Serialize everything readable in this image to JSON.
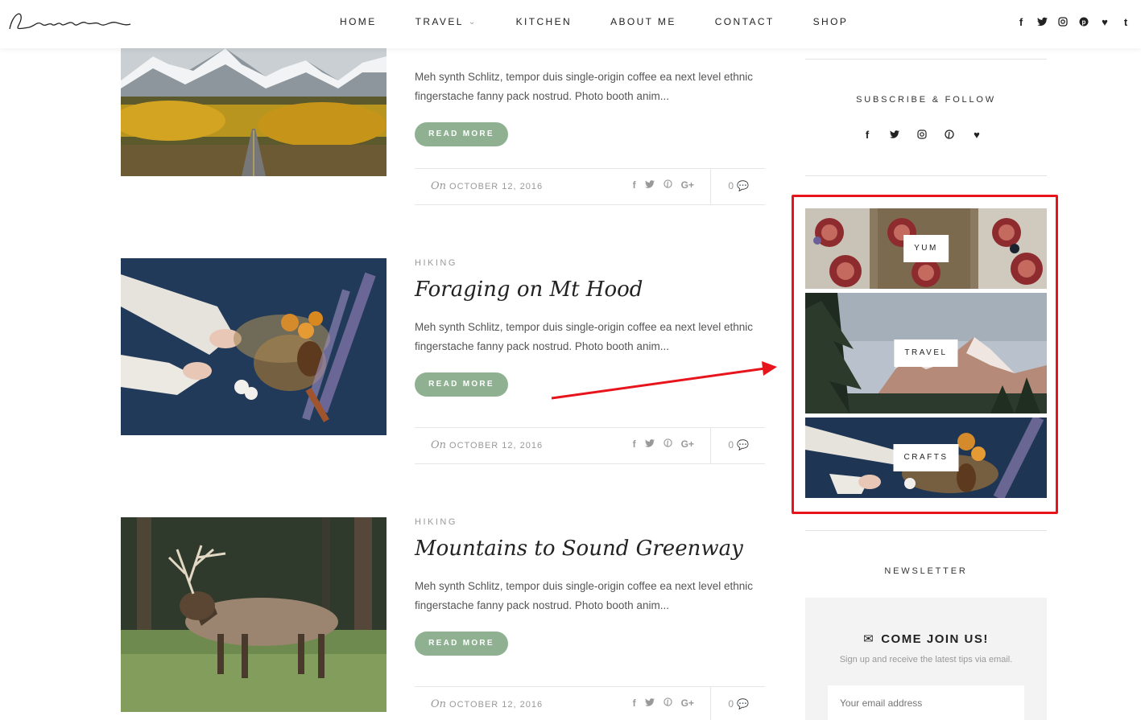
{
  "header": {
    "logo_text": "Laurel",
    "nav": [
      {
        "label": "HOME"
      },
      {
        "label": "TRAVEL"
      },
      {
        "label": "KITCHEN"
      },
      {
        "label": "ABOUT ME"
      },
      {
        "label": "CONTACT"
      },
      {
        "label": "SHOP"
      }
    ],
    "social": [
      {
        "icon": "facebook-icon",
        "glyph": "f"
      },
      {
        "icon": "twitter-icon",
        "glyph": "🐦"
      },
      {
        "icon": "instagram-icon",
        "glyph": "◎"
      },
      {
        "icon": "pinterest-icon",
        "glyph": "℗"
      },
      {
        "icon": "heart-icon",
        "glyph": "♥"
      },
      {
        "icon": "tumblr-icon",
        "glyph": "t"
      }
    ]
  },
  "posts": [
    {
      "category": "",
      "title": "",
      "excerpt": "Meh synth Schlitz, tempor duis single-origin coffee ea next level ethnic fingerstache fanny pack nostrud. Photo booth anim...",
      "button": "READ MORE",
      "date_prefix": "On",
      "date": "OCTOBER 12, 2016",
      "comments": "0"
    },
    {
      "category": "HIKING",
      "title": "Foraging on Mt Hood",
      "excerpt": "Meh synth Schlitz, tempor duis single-origin coffee ea next level ethnic fingerstache fanny pack nostrud. Photo booth anim...",
      "button": "READ MORE",
      "date_prefix": "On",
      "date": "OCTOBER 12, 2016",
      "comments": "0"
    },
    {
      "category": "HIKING",
      "title": "Mountains to Sound Greenway",
      "excerpt": "Meh synth Schlitz, tempor duis single-origin coffee ea next level ethnic fingerstache fanny pack nostrud. Photo booth anim...",
      "button": "READ MORE",
      "date_prefix": "On",
      "date": "OCTOBER 12, 2016",
      "comments": "0"
    }
  ],
  "share_icons": [
    "f",
    "🐦",
    "℗",
    "G+"
  ],
  "sidebar": {
    "subscribe_title": "SUBSCRIBE & FOLLOW",
    "promos": [
      {
        "label": "YUM"
      },
      {
        "label": "TRAVEL"
      },
      {
        "label": "CRAFTS"
      }
    ],
    "newsletter_title": "NEWSLETTER",
    "newsletter_heading": "COME JOIN US!",
    "newsletter_sub": "Sign up and receive the latest tips via email.",
    "email_placeholder": "Your email address"
  },
  "colors": {
    "accent": "#8fb192",
    "highlight": "#e8141b"
  }
}
